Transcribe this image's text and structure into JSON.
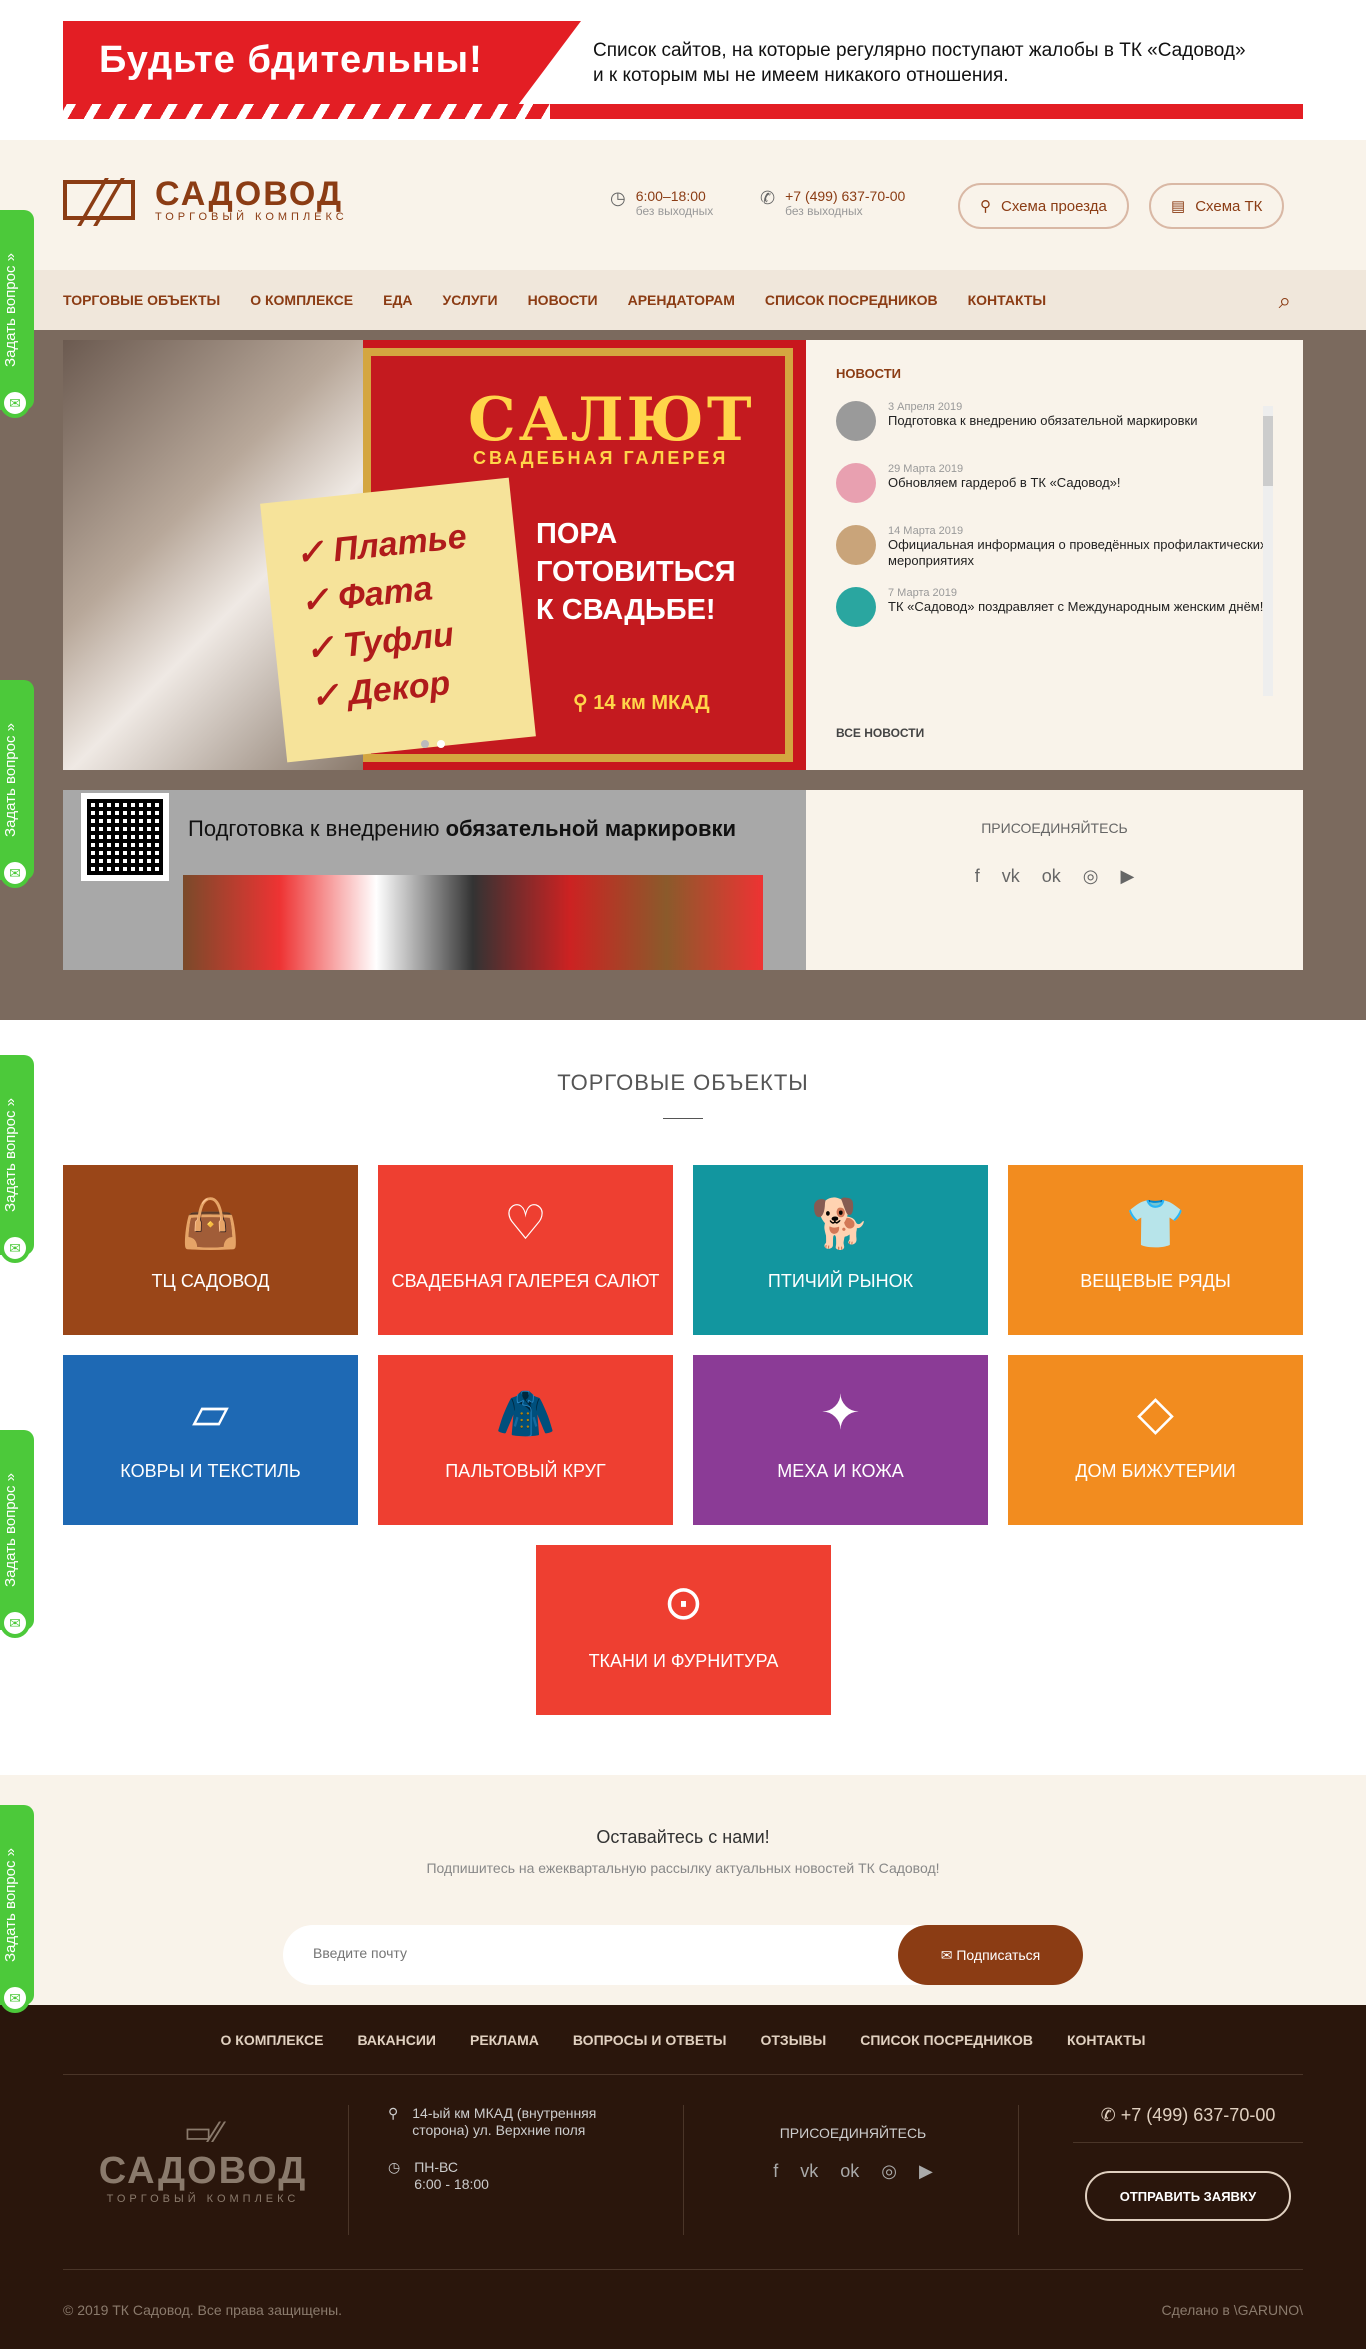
{
  "alert_banner": {
    "headline": "Будьте  бдительны!",
    "text_line1": "Список сайтов, на которые регулярно поступают жалобы в ТК «Садовод»",
    "text_line2": "и к которым мы не имеем никакого отношения."
  },
  "header": {
    "logo_name": "САДОВОД",
    "logo_sub": "ТОРГОВЫЙ КОМПЛЕКС",
    "hours": "6:00–18:00",
    "hours_note": "без выходных",
    "phone": "+7 (499) 637-70-00",
    "phone_note": "без выходных",
    "route_button": "Схема проезда",
    "map_button": "Схема ТК"
  },
  "nav": {
    "items": [
      "ТОРГОВЫЕ ОБЪЕКТЫ",
      "О КОМПЛЕКСЕ",
      "ЕДА",
      "УСЛУГИ",
      "НОВОСТИ",
      "АРЕНДАТОРАМ",
      "СПИСОК ПОСРЕДНИКОВ",
      "КОНТАКТЫ"
    ]
  },
  "slider": {
    "title": "САЛЮТ",
    "subtitle": "СВАДЕБНАЯ ГАЛЕРЕЯ",
    "list": [
      "✓ Платье",
      "✓ Фата",
      "✓ Туфли",
      "✓ Декор"
    ],
    "message_line1": "ПОРА",
    "message_line2": "ГОТОВИТЬСЯ",
    "message_line3": "К СВАДЬБЕ!",
    "location": "14 км МКАД"
  },
  "news": {
    "heading": "НОВОСТИ",
    "items": [
      {
        "date": "3 Апреля 2019",
        "title": "Подготовка к внедрению обязательной маркировки",
        "color": "#9a9a9a"
      },
      {
        "date": "29 Марта 2019",
        "title": "Обновляем гардероб в ТК «Садовод»!",
        "color": "#e8a0b0"
      },
      {
        "date": "14 Марта 2019",
        "title": "Официальная информация о проведённых профилактических мероприятиях",
        "color": "#c9a47a"
      },
      {
        "date": "7 Марта 2019",
        "title": "ТК «Садовод» поздравляет с Международным женским днём!",
        "color": "#2aa6a0"
      }
    ],
    "all_link": "ВСЕ НОВОСТИ"
  },
  "promo": {
    "text_plain": "Подготовка к внедрению ",
    "text_bold": "обязательной маркировки"
  },
  "join": {
    "heading": "ПРИСОЕДИНЯЙТЕСЬ",
    "socials": [
      "f",
      "vk",
      "ok",
      "◎",
      "▶"
    ]
  },
  "objects": {
    "heading": "ТОРГОВЫЕ ОБЪЕКТЫ",
    "tiles": [
      {
        "label": "ТЦ САДОВОД",
        "icon": "bag-icon",
        "glyph": "👜",
        "color": "#9a4618"
      },
      {
        "label": "СВАДЕБНАЯ ГАЛЕРЕЯ САЛЮТ",
        "icon": "heart-lock-icon",
        "glyph": "♡",
        "color": "#ee3f31"
      },
      {
        "label": "ПТИЧИЙ РЫНОК",
        "icon": "dog-icon",
        "glyph": "🐕",
        "color": "#12969f"
      },
      {
        "label": "ВЕЩЕВЫЕ РЯДЫ",
        "icon": "shirt-icon",
        "glyph": "👕",
        "color": "#f28c1f"
      },
      {
        "label": "КОВРЫ И ТЕКСТИЛЬ",
        "icon": "carpet-icon",
        "glyph": "▱",
        "color": "#1e69b4"
      },
      {
        "label": "ПАЛЬТОВЫЙ КРУГ",
        "icon": "coat-icon",
        "glyph": "🧥",
        "color": "#ee3f31"
      },
      {
        "label": "МЕХА И КОЖА",
        "icon": "leather-icon",
        "glyph": "✦",
        "color": "#8b3b96"
      },
      {
        "label": "ДОМ БИЖУТЕРИИ",
        "icon": "diamond-icon",
        "glyph": "◇",
        "color": "#f28c1f"
      },
      {
        "label": "ТКАНИ И ФУРНИТУРА",
        "icon": "button-icon",
        "glyph": "⊙",
        "color": "#ee3f31"
      }
    ]
  },
  "subscribe": {
    "heading": "Оставайтесь с нами!",
    "text": "Подпишитесь на ежеквартальную рассылку актуальных новостей ТК Садовод!",
    "placeholder": "Введите почту",
    "button": "✉  Подписаться"
  },
  "footer": {
    "nav": [
      "О КОМПЛЕКСЕ",
      "ВАКАНСИИ",
      "РЕКЛАМА",
      "ВОПРОСЫ И ОТВЕТЫ",
      "ОТЗЫВЫ",
      "СПИСОК ПОСРЕДНИКОВ",
      "КОНТАКТЫ"
    ],
    "logo_name": "САДОВОД",
    "logo_sub": "ТОРГОВЫЙ КОМПЛЕКС",
    "address": "14-ый км МКАД (внутренняя сторона) ул. Верхние поля",
    "schedule_days": "ПН-ВС",
    "schedule_hours": "6:00 - 18:00",
    "join": "ПРИСОЕДИНЯЙТЕСЬ",
    "phone": "+7 (499) 637-70-00",
    "request_button": "ОТПРАВИТЬ ЗАЯВКУ",
    "copyright": "© 2019 ТК Садовод. Все права защищены.",
    "made_by": "Сделано в \\GARUNO\\"
  },
  "ask_widget": {
    "label": "Задать вопрос »"
  }
}
